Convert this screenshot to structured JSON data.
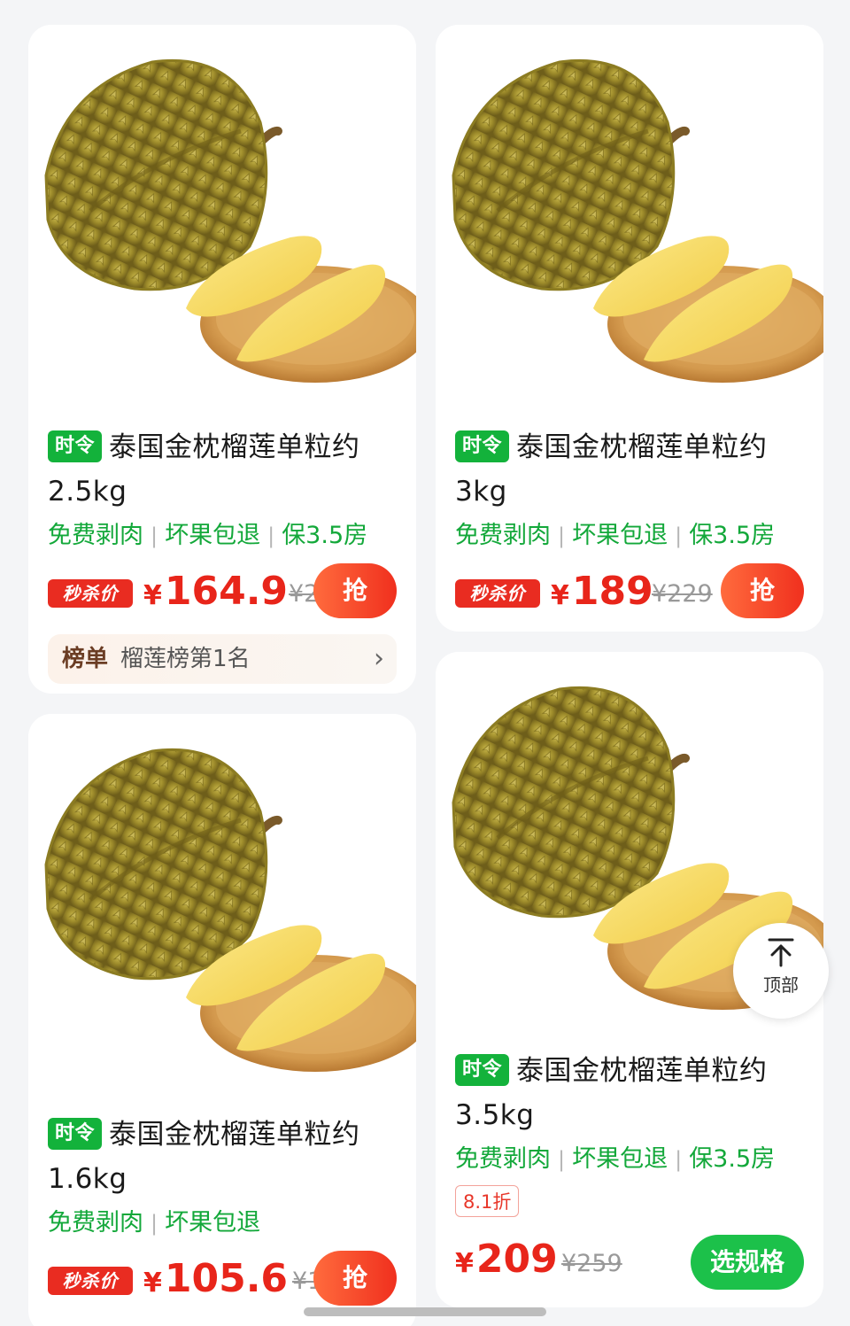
{
  "colors": {
    "accent_green": "#13b23b",
    "price_red": "#e8251a",
    "grab_button_orange": "#f0301e",
    "spec_button_green": "#1cc14a"
  },
  "products": [
    {
      "season_tag": "时令",
      "title": "泰国金枕榴莲单粒约2.5kg",
      "features": [
        "免费剥肉",
        "坏果包退",
        "保3.5房"
      ],
      "flash_tag": "秒杀价",
      "currency": "¥",
      "price": "164.9",
      "original_price": "¥20",
      "button": "抢",
      "rank": {
        "label": "榜单",
        "text": "榴莲榜第1名",
        "chevron": "›"
      }
    },
    {
      "season_tag": "时令",
      "title": "泰国金枕榴莲单粒约3kg",
      "features": [
        "免费剥肉",
        "坏果包退",
        "保3.5房"
      ],
      "flash_tag": "秒杀价",
      "currency": "¥",
      "price": "189",
      "original_price": "¥229",
      "button": "抢"
    },
    {
      "season_tag": "时令",
      "title": "泰国金枕榴莲单粒约1.6kg",
      "features": [
        "免费剥肉",
        "坏果包退"
      ],
      "flash_tag": "秒杀价",
      "currency": "¥",
      "price": "105.6",
      "original_price": "¥13",
      "button": "抢"
    },
    {
      "season_tag": "时令",
      "title": "泰国金枕榴莲单粒约3.5kg",
      "features": [
        "免费剥肉",
        "坏果包退",
        "保3.5房"
      ],
      "discount": "8.1折",
      "currency": "¥",
      "price": "209",
      "original_price": "¥259",
      "button": "选规格"
    }
  ],
  "back_to_top": {
    "label": "顶部",
    "icon": "arrow-up-to-line-icon"
  }
}
